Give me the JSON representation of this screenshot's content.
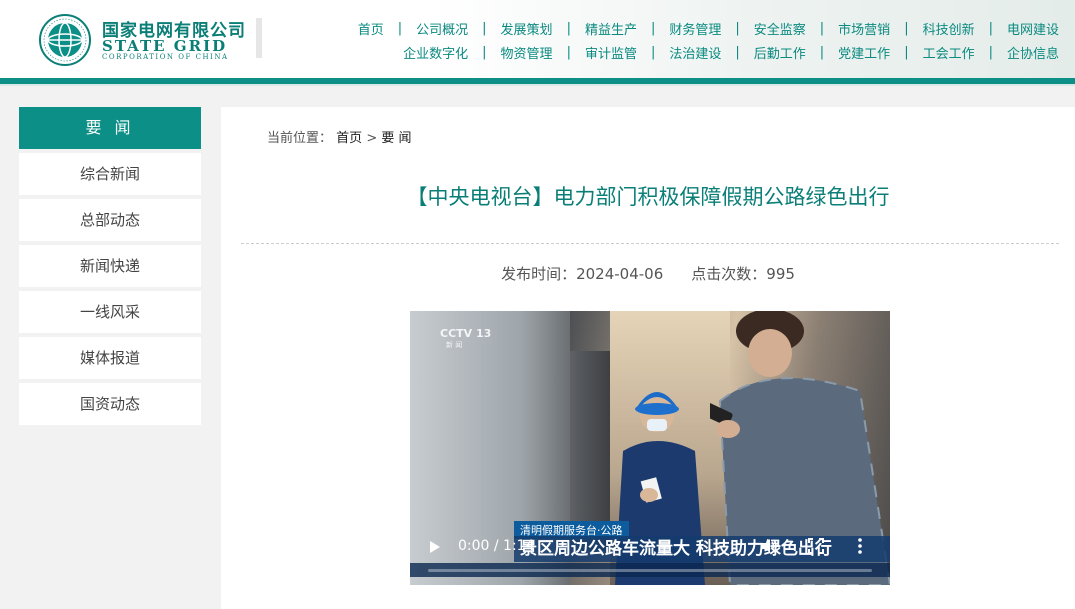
{
  "header": {
    "logo_cn": "国家电网有限公司",
    "logo_en": "STATE GRID",
    "logo_en_sub": "CORPORATION OF CHINA",
    "nav_row1": [
      "首页",
      "公司概况",
      "发展策划",
      "精益生产",
      "财务管理",
      "安全监察",
      "市场营销",
      "科技创新",
      "电网建设"
    ],
    "nav_row2": [
      "企业数字化",
      "物资管理",
      "审计监管",
      "法治建设",
      "后勤工作",
      "党建工作",
      "工会工作",
      "企协信息"
    ],
    "separator": "|"
  },
  "sidebar": {
    "heading": "要 闻",
    "items": [
      "综合新闻",
      "总部动态",
      "新闻快递",
      "一线风采",
      "媒体报道",
      "国资动态"
    ]
  },
  "breadcrumb": {
    "prefix": "当前位置：",
    "home": "首页",
    "sep": ">",
    "current": "要 闻"
  },
  "article": {
    "title": "【中央电视台】电力部门积极保障假期公路绿色出行",
    "publish_label": "发布时间：",
    "publish_date": "2024-04-06",
    "clicks_label": "点击次数：",
    "clicks": "995"
  },
  "video": {
    "channel_logo": "CCTV 13",
    "channel_sub": "新 闻",
    "tag": "清明假期服务台·公路",
    "caption": "景区周边公路车流量大 科技助力绿色出行",
    "time": "0:00 / 1:14",
    "progress": 0.0,
    "icons": [
      "play-icon",
      "volume-icon",
      "fullscreen-icon",
      "more-icon"
    ]
  },
  "colors": {
    "brand": "#0b8f86",
    "title": "#0b7f77"
  }
}
